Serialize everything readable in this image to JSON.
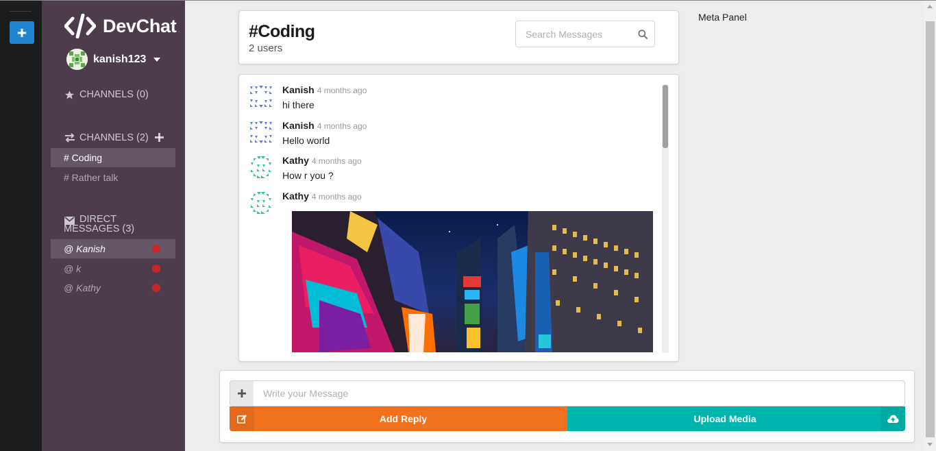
{
  "app": {
    "name": "DevChat"
  },
  "user": {
    "name": "kanish123"
  },
  "sidebar": {
    "starred": {
      "label": "CHANNELS (0)"
    },
    "channels": {
      "label": "CHANNELS (2)",
      "items": [
        {
          "label": "# Coding",
          "active": true
        },
        {
          "label": "# Rather talk",
          "active": false
        }
      ]
    },
    "direct": {
      "label_line1": "DIRECT",
      "label_line2": "MESSAGES (3)",
      "items": [
        {
          "label": "@ Kanish",
          "active": true,
          "status": "offline"
        },
        {
          "label": "@ k",
          "active": false,
          "status": "offline"
        },
        {
          "label": "@ Kathy",
          "active": false,
          "status": "offline"
        }
      ]
    }
  },
  "header": {
    "channel": "#Coding",
    "users": "2 users",
    "search_placeholder": "Search Messages"
  },
  "messages": [
    {
      "author": "Kanish",
      "time": "4 months ago",
      "text": "hi there"
    },
    {
      "author": "Kanish",
      "time": "4 months ago",
      "text": "Hello world"
    },
    {
      "author": "Kathy",
      "time": "4 months ago",
      "text": "How r you ?"
    },
    {
      "author": "Kathy",
      "time": "4 months ago",
      "image": "times-square-night-photo"
    }
  ],
  "meta_panel": {
    "title": "Meta Panel"
  },
  "form": {
    "placeholder": "Write your Message",
    "reply_label": "Add Reply",
    "upload_label": "Upload Media"
  },
  "colors": {
    "sidebar": "#4c3c4c",
    "rail": "#1b1c1d",
    "accent_blue": "#2185d0",
    "reply_orange": "#f2711c",
    "upload_teal": "#00b5ad",
    "status_red": "#c62828"
  },
  "icons": [
    "plus-icon",
    "code-icon",
    "star-icon",
    "exchange-icon",
    "envelope-icon",
    "search-icon",
    "edit-icon",
    "cloud-upload-icon"
  ]
}
